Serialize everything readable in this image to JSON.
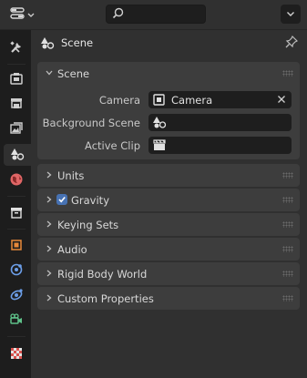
{
  "header": {
    "editor_type_icon": "properties-editor-icon",
    "search_placeholder": "",
    "options_icon": "chevron-down-icon"
  },
  "tabs": [
    {
      "name": "tool",
      "icon": "wrench-screwdriver-icon",
      "active": false
    },
    {
      "name": "render",
      "icon": "camera-back-icon",
      "active": false
    },
    {
      "name": "output",
      "icon": "printer-icon",
      "active": false
    },
    {
      "name": "view-layer",
      "icon": "image-stack-icon",
      "active": false
    },
    {
      "name": "scene",
      "icon": "scene-icon",
      "active": true
    },
    {
      "name": "world",
      "icon": "world-icon",
      "active": false
    },
    {
      "name": "collection",
      "icon": "collection-box-icon",
      "active": false
    },
    {
      "name": "object",
      "icon": "object-square-icon",
      "active": false
    },
    {
      "name": "modifiers",
      "icon": "physics-orbit-icon",
      "active": false
    },
    {
      "name": "particles",
      "icon": "constraints-icon",
      "active": false
    },
    {
      "name": "data",
      "icon": "camera-data-icon",
      "active": false
    },
    {
      "name": "texture",
      "icon": "checker-texture-icon",
      "active": false
    }
  ],
  "context": {
    "title": "Scene"
  },
  "scene_panel": {
    "title": "Scene",
    "camera_label": "Camera",
    "camera_value": "Camera",
    "background_scene_label": "Background Scene",
    "background_scene_value": "",
    "active_clip_label": "Active Clip",
    "active_clip_value": ""
  },
  "collapsed_panels": [
    {
      "title": "Units",
      "checkbox": false
    },
    {
      "title": "Gravity",
      "checkbox": true,
      "checked": true
    },
    {
      "title": "Keying Sets",
      "checkbox": false
    },
    {
      "title": "Audio",
      "checkbox": false
    },
    {
      "title": "Rigid Body World",
      "checkbox": false
    },
    {
      "title": "Custom Properties",
      "checkbox": false
    }
  ],
  "colors": {
    "accent": "#4772b3",
    "panel": "#3d3d3d",
    "background": "#303030",
    "field": "#1e1e1e"
  }
}
